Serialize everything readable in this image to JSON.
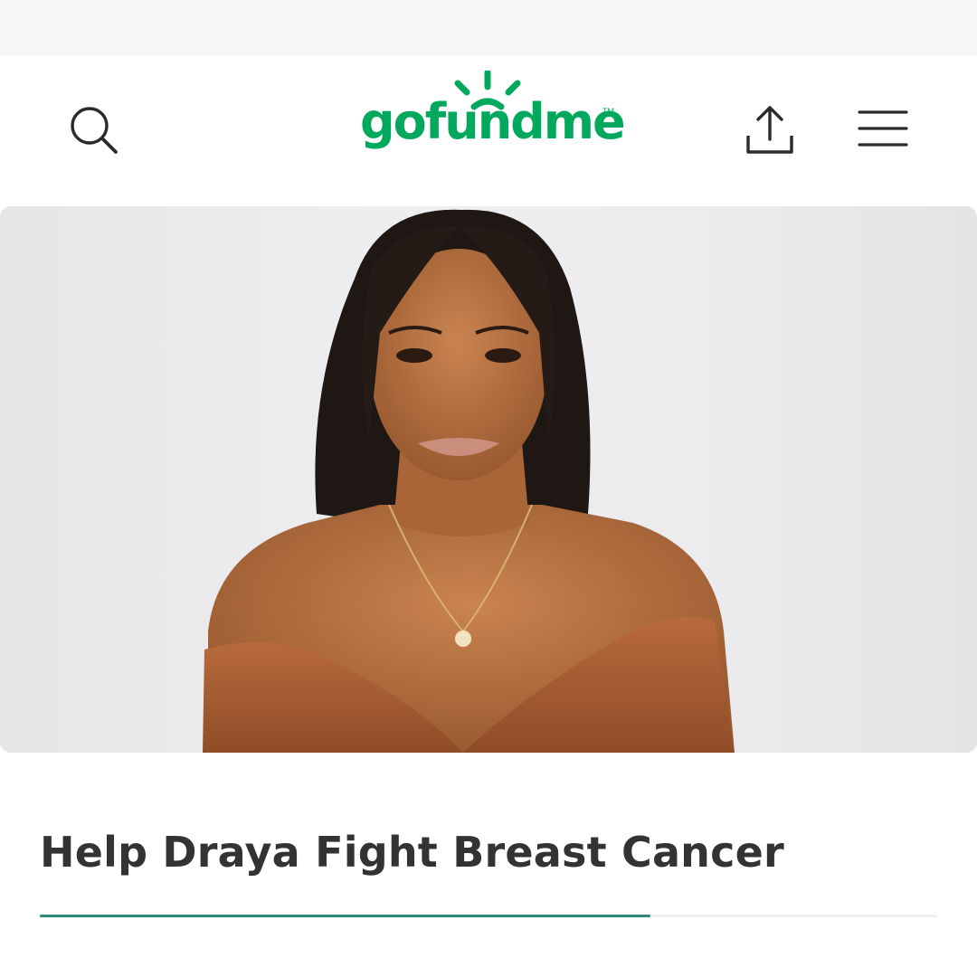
{
  "header": {
    "logo_text": "gofundme",
    "logo_tm": "TM",
    "search_icon": "search-icon",
    "share_icon": "share-icon",
    "menu_icon": "hamburger-menu-icon",
    "brand_color": "#02a95c"
  },
  "campaign": {
    "title": "Help Draya Fight Breast Cancer",
    "image": "portrait-photo",
    "progress_fraction": 0.68,
    "progress_color": "#2d8a78"
  }
}
